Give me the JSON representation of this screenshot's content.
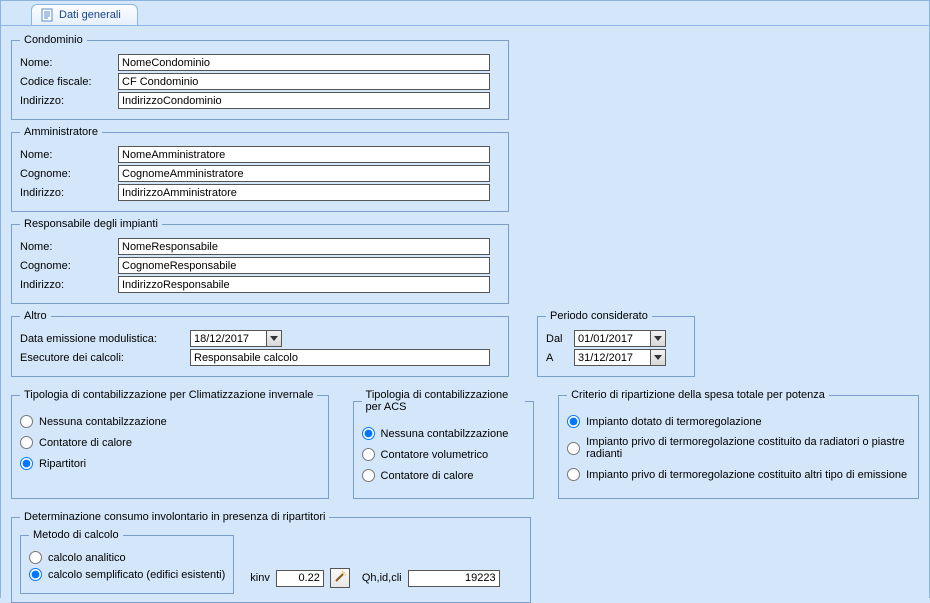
{
  "tab": {
    "label": "Dati generali"
  },
  "condominio": {
    "legend": "Condominio",
    "nome_lbl": "Nome:",
    "nome": "NomeCondominio",
    "cf_lbl": "Codice fiscale:",
    "cf": "CF Condominio",
    "ind_lbl": "Indirizzo:",
    "ind": "IndirizzoCondominio"
  },
  "amministratore": {
    "legend": "Amministratore",
    "nome_lbl": "Nome:",
    "nome": "NomeAmministratore",
    "cog_lbl": "Cognome:",
    "cog": "CognomeAmministratore",
    "ind_lbl": "Indirizzo:",
    "ind": "IndirizzoAmministratore"
  },
  "responsabile": {
    "legend": "Responsabile degli impianti",
    "nome_lbl": "Nome:",
    "nome": "NomeResponsabile",
    "cog_lbl": "Cognome:",
    "cog": "CognomeResponsabile",
    "ind_lbl": "Indirizzo:",
    "ind": "IndirizzoResponsabile"
  },
  "altro": {
    "legend": "Altro",
    "data_lbl": "Data emissione modulistica:",
    "data": "18/12/2017",
    "esec_lbl": "Esecutore dei calcoli:",
    "esec": "Responsabile calcolo"
  },
  "periodo": {
    "legend": "Periodo considerato",
    "dal_lbl": "Dal",
    "dal": "01/01/2017",
    "a_lbl": "A",
    "a": "31/12/2017"
  },
  "tipoclim": {
    "legend": "Tipologia di contabilizzazione per Climatizzazione invernale",
    "opt1": "Nessuna contabilzzazione",
    "opt2": "Contatore di calore",
    "opt3": "Ripartitori"
  },
  "tipoacs": {
    "legend": "Tipologia di contabilizzazione per ACS",
    "opt1": "Nessuna contabilzzazione",
    "opt2": "Contatore volumetrico",
    "opt3": "Contatore di calore"
  },
  "criterio": {
    "legend": "Criterio di ripartizione della spesa totale per potenza",
    "opt1": "Impianto dotato di termoregolazione",
    "opt2": "Impianto privo di termoregolazione costituito da radiatori o piastre radianti",
    "opt3": "Impianto privo di termoregolazione costituito altri tipo di emissione"
  },
  "determinazione": {
    "legend": "Determinazione consumo involontario in presenza di ripartitori",
    "metodo_legend": "Metodo di calcolo",
    "opt1": "calcolo analitico",
    "opt2": "calcolo semplificato (edifici esistenti)",
    "kinv_lbl": "kinv",
    "kinv": "0.22",
    "qh_lbl": "Qh,id,cli",
    "qh": "19223"
  }
}
